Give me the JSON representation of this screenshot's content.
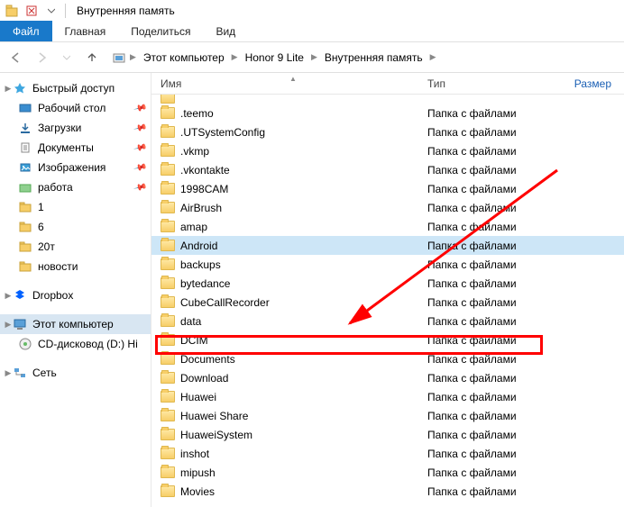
{
  "titlebar": {
    "title": "Внутренняя память"
  },
  "ribbon": {
    "file": "Файл",
    "tabs": [
      "Главная",
      "Поделиться",
      "Вид"
    ]
  },
  "breadcrumb": {
    "items": [
      "Этот компьютер",
      "Honor 9 Lite",
      "Внутренняя память"
    ]
  },
  "columns": {
    "name": "Имя",
    "type": "Тип",
    "size": "Размер"
  },
  "sidebar": {
    "quick": {
      "label": "Быстрый доступ"
    },
    "quick_items": [
      {
        "label": "Рабочий стол",
        "ico": "desktop",
        "pin": true
      },
      {
        "label": "Загрузки",
        "ico": "downloads",
        "pin": true
      },
      {
        "label": "Документы",
        "ico": "documents",
        "pin": true
      },
      {
        "label": "Изображения",
        "ico": "pictures",
        "pin": true
      },
      {
        "label": "работа",
        "ico": "folder-green",
        "pin": true
      },
      {
        "label": "1",
        "ico": "folder",
        "pin": false
      },
      {
        "label": "6",
        "ico": "folder",
        "pin": false
      },
      {
        "label": "20т",
        "ico": "folder",
        "pin": false
      },
      {
        "label": "новости",
        "ico": "folder",
        "pin": false
      }
    ],
    "dropbox": {
      "label": "Dropbox"
    },
    "thispc": {
      "label": "Этот компьютер"
    },
    "cd": {
      "label": "CD-дисковод (D:) Hi"
    },
    "network": {
      "label": "Сеть"
    }
  },
  "folder_type": "Папка с файлами",
  "files": [
    {
      "name": ".teemo"
    },
    {
      "name": ".UTSystemConfig"
    },
    {
      "name": ".vkmp"
    },
    {
      "name": ".vkontakte"
    },
    {
      "name": "1998CAM"
    },
    {
      "name": "AirBrush"
    },
    {
      "name": "amap"
    },
    {
      "name": "Android",
      "selected": true
    },
    {
      "name": "backups"
    },
    {
      "name": "bytedance"
    },
    {
      "name": "CubeCallRecorder"
    },
    {
      "name": "data"
    },
    {
      "name": "DCIM",
      "highlighted": true
    },
    {
      "name": "Documents"
    },
    {
      "name": "Download"
    },
    {
      "name": "Huawei"
    },
    {
      "name": "Huawei Share"
    },
    {
      "name": "HuaweiSystem"
    },
    {
      "name": "inshot"
    },
    {
      "name": "mipush"
    },
    {
      "name": "Movies"
    }
  ]
}
